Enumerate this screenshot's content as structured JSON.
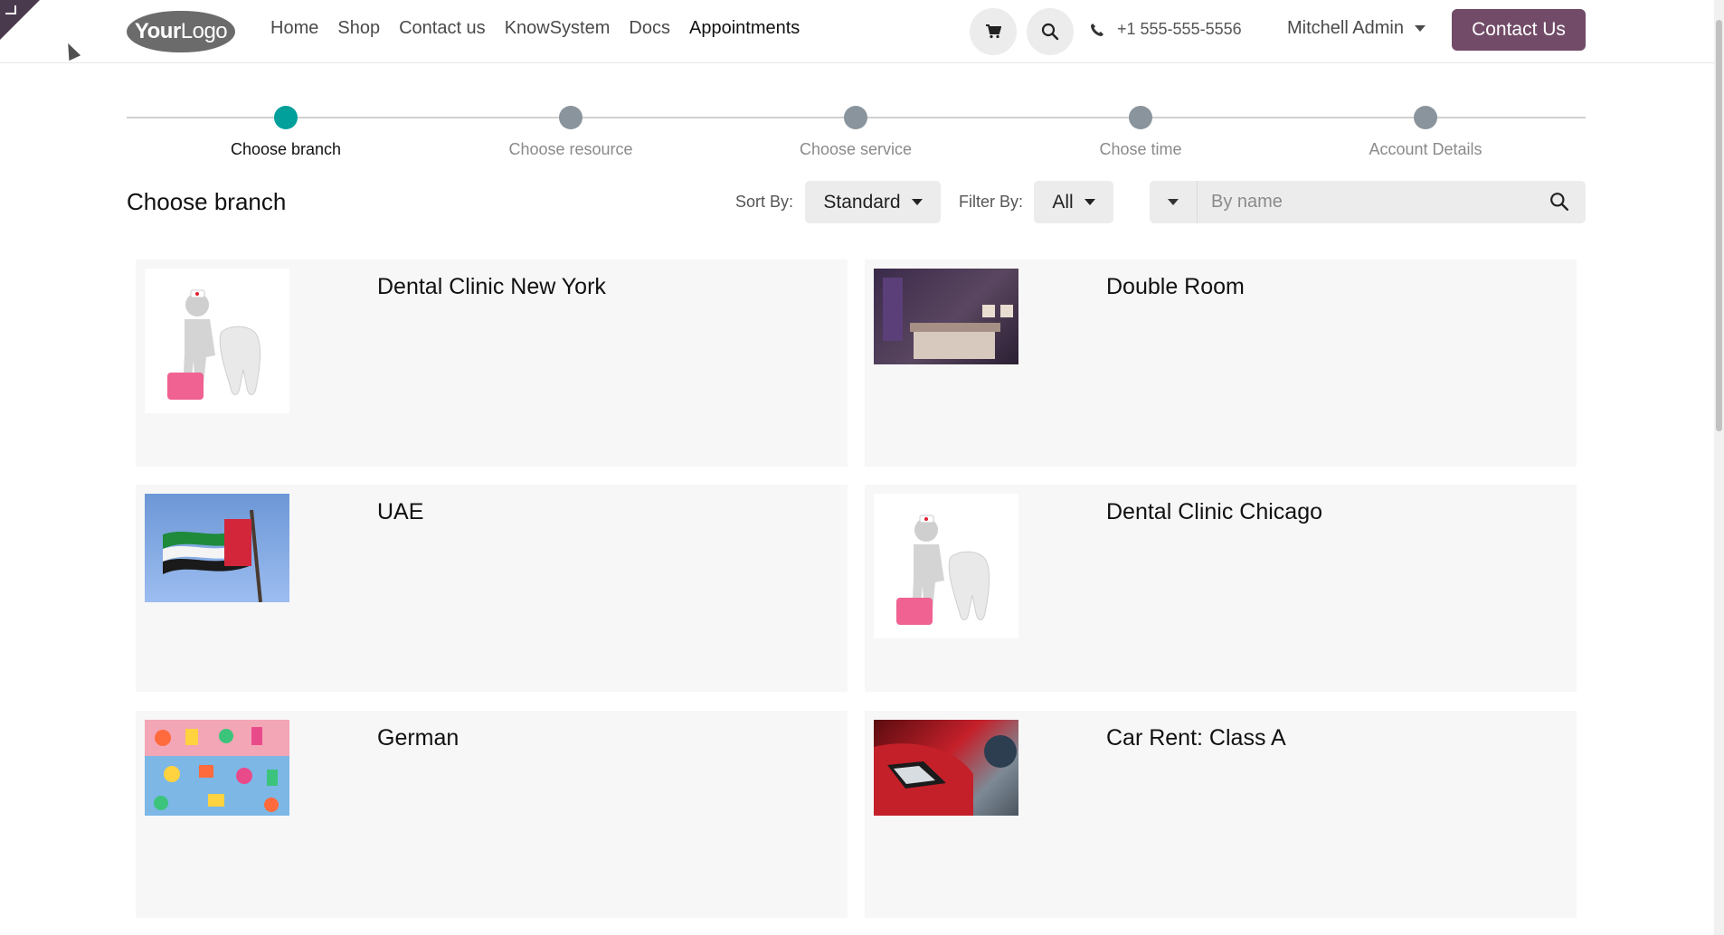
{
  "header": {
    "logo_text_bold": "Your",
    "logo_text_light": "Logo",
    "nav": [
      {
        "label": "Home"
      },
      {
        "label": "Shop"
      },
      {
        "label": "Contact us"
      },
      {
        "label": "KnowSystem"
      },
      {
        "label": "Docs"
      },
      {
        "label": "Appointments",
        "active": true
      }
    ],
    "phone": "+1 555-555-5556",
    "user": "Mitchell Admin",
    "contact_button": "Contact Us",
    "icons": [
      "cart-icon",
      "search-icon",
      "phone-icon"
    ]
  },
  "stepper": {
    "steps": [
      {
        "label": "Choose branch",
        "active": true
      },
      {
        "label": "Choose resource"
      },
      {
        "label": "Choose service"
      },
      {
        "label": "Chose time"
      },
      {
        "label": "Account Details"
      }
    ],
    "active_color": "#01a09a",
    "inactive_color": "#8a949c"
  },
  "toolbar": {
    "title": "Choose branch",
    "sort_label": "Sort By:",
    "sort_value": "Standard",
    "filter_label": "Filter By:",
    "filter_value": "All",
    "search_placeholder": "By name"
  },
  "branches": [
    {
      "name": "Dental Clinic New York",
      "image": "dentist-tooth-illustration"
    },
    {
      "name": "Double Room",
      "image": "hotel-room-photo"
    },
    {
      "name": "UAE",
      "image": "uae-flag-photo"
    },
    {
      "name": "Dental Clinic Chicago",
      "image": "dentist-tooth-illustration"
    },
    {
      "name": "German",
      "image": "alphabet-letters-photo"
    },
    {
      "name": "Car Rent: Class A",
      "image": "red-car-photo"
    }
  ],
  "colors": {
    "brand": "#714b67",
    "card_bg": "#f7f7f7"
  }
}
